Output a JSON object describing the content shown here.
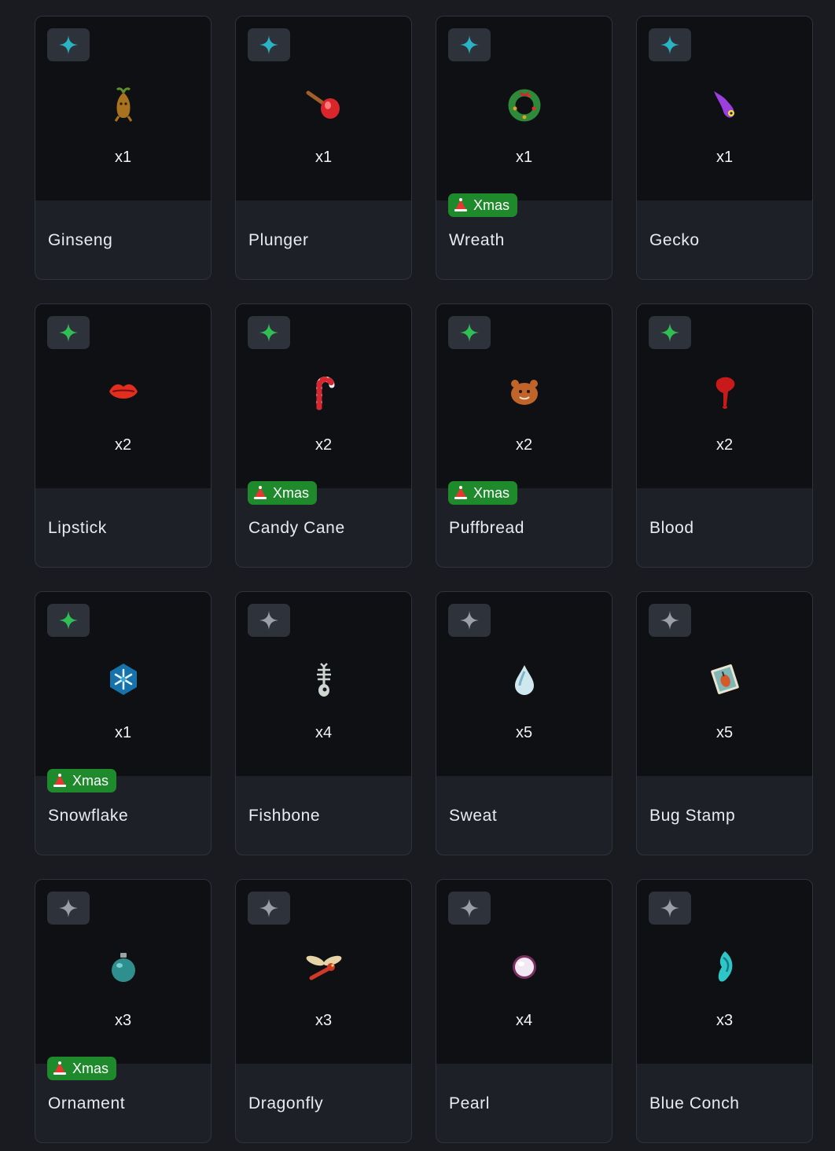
{
  "colors": {
    "page_bg": "#191b21",
    "card_bg": "#1d2027",
    "card_top_bg": "#0f1014",
    "rarity_teal": "#2ab3c4",
    "rarity_green": "#2fbf55",
    "rarity_gray": "#9aa0a8",
    "badge_green": "#1f8a2c"
  },
  "items": [
    {
      "name": "Ginseng",
      "qty": "x1",
      "rarity": "teal",
      "icon": "ginseng-icon",
      "icon_color": "#a8721f",
      "badge": ""
    },
    {
      "name": "Plunger",
      "qty": "x1",
      "rarity": "teal",
      "icon": "plunger-icon",
      "icon_color": "#d8262b",
      "badge": ""
    },
    {
      "name": "Wreath",
      "qty": "x1",
      "rarity": "teal",
      "icon": "wreath-icon",
      "icon_color": "#2e8a3a",
      "badge": "Xmas"
    },
    {
      "name": "Gecko",
      "qty": "x1",
      "rarity": "teal",
      "icon": "gecko-icon",
      "icon_color": "#9b3fe0",
      "badge": ""
    },
    {
      "name": "Lipstick",
      "qty": "x2",
      "rarity": "green",
      "icon": "lips-icon",
      "icon_color": "#e12e1f",
      "badge": ""
    },
    {
      "name": "Candy Cane",
      "qty": "x2",
      "rarity": "green",
      "icon": "candy-cane-icon",
      "icon_color": "#d6262f",
      "badge": "Xmas"
    },
    {
      "name": "Puffbread",
      "qty": "x2",
      "rarity": "green",
      "icon": "gingerbread-icon",
      "icon_color": "#c0642a",
      "badge": "Xmas"
    },
    {
      "name": "Blood",
      "qty": "x2",
      "rarity": "green",
      "icon": "blood-drop-icon",
      "icon_color": "#c81a1a",
      "badge": ""
    },
    {
      "name": "Snowflake",
      "qty": "x1",
      "rarity": "green",
      "icon": "snowflake-icon",
      "icon_color": "#2fa9d6",
      "badge": "Xmas"
    },
    {
      "name": "Fishbone",
      "qty": "x4",
      "rarity": "gray",
      "icon": "fishbone-icon",
      "icon_color": "#cfd6d2",
      "badge": ""
    },
    {
      "name": "Sweat",
      "qty": "x5",
      "rarity": "gray",
      "icon": "water-drop-icon",
      "icon_color": "#cfe7ef",
      "badge": ""
    },
    {
      "name": "Bug Stamp",
      "qty": "x5",
      "rarity": "gray",
      "icon": "stamp-icon",
      "icon_color": "#7fb6b8",
      "badge": ""
    },
    {
      "name": "Ornament",
      "qty": "x3",
      "rarity": "gray",
      "icon": "ornament-icon",
      "icon_color": "#2f8f8f",
      "badge": "Xmas"
    },
    {
      "name": "Dragonfly",
      "qty": "x3",
      "rarity": "gray",
      "icon": "dragonfly-icon",
      "icon_color": "#d0382a",
      "badge": ""
    },
    {
      "name": "Pearl",
      "qty": "x4",
      "rarity": "gray",
      "icon": "pearl-icon",
      "icon_color": "#f2e8f4",
      "badge": ""
    },
    {
      "name": "Blue Conch",
      "qty": "x3",
      "rarity": "gray",
      "icon": "conch-icon",
      "icon_color": "#2fc6c8",
      "badge": ""
    }
  ]
}
